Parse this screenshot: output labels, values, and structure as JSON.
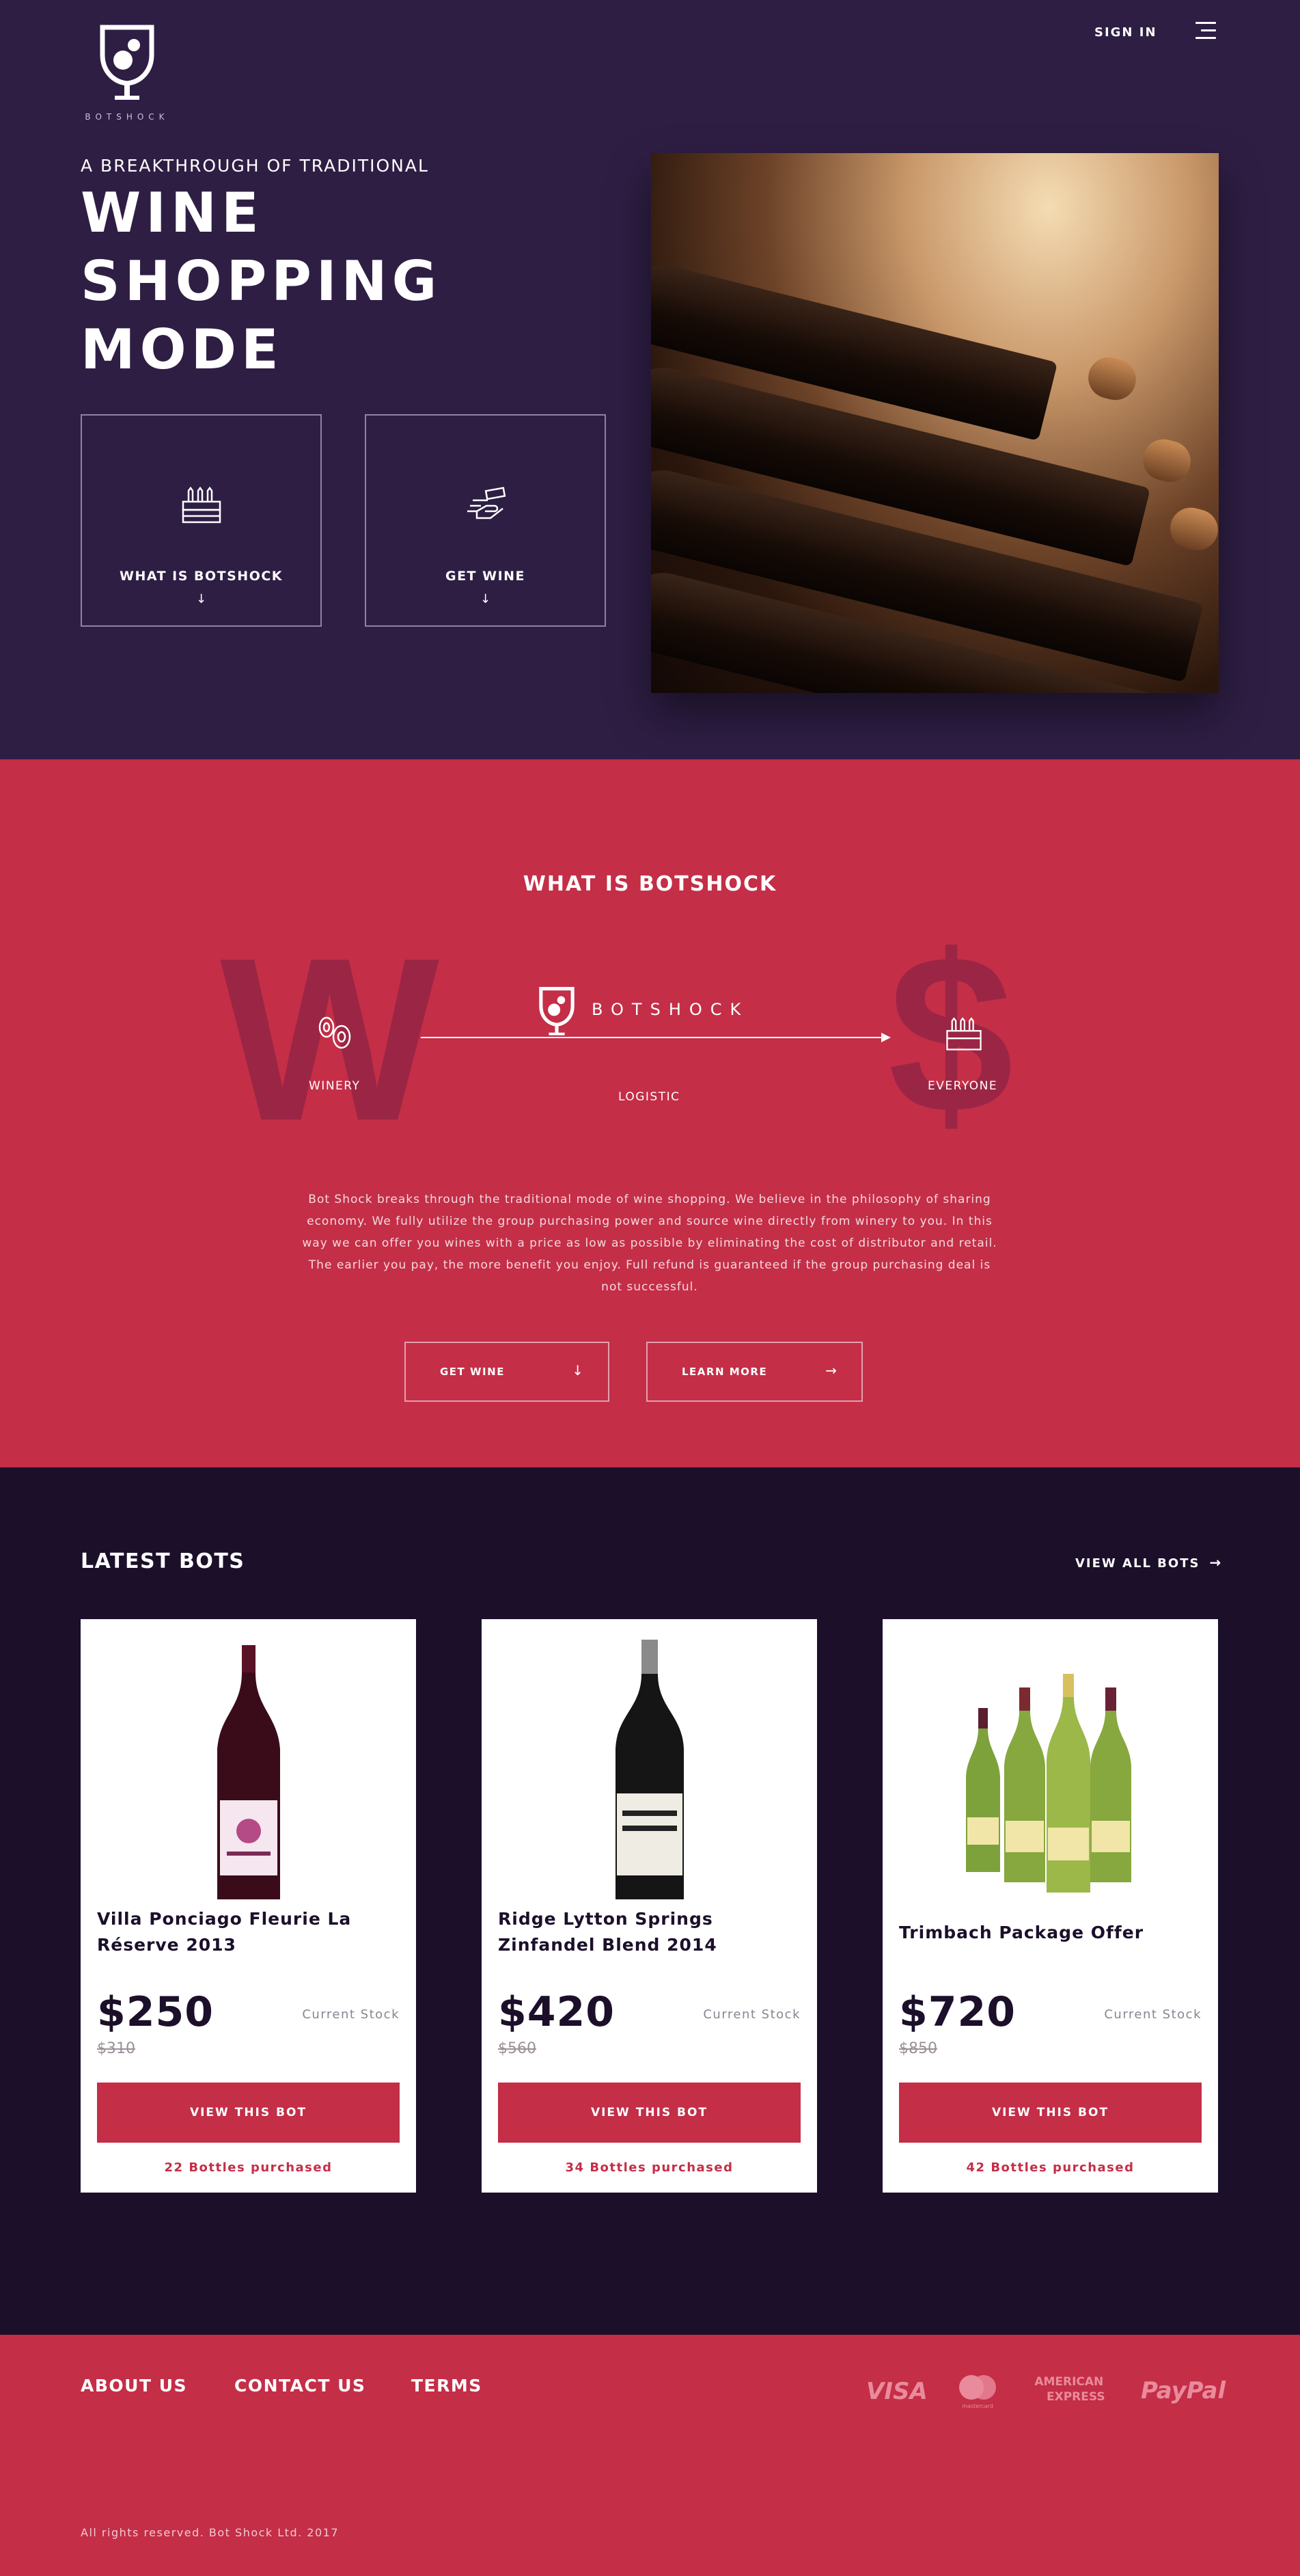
{
  "colors": {
    "hero_bg": "#2e1e44",
    "accent": "#c42e47",
    "dark_bg": "#1b0f2a"
  },
  "header": {
    "logo_text": "BOTSHOCK",
    "signin_label": "SIGN IN",
    "menu_icon": "hamburger-icon"
  },
  "hero": {
    "tagline": "A BREAKTHROUGH OF TRADITIONAL",
    "headline": "WINE SHOPPING MODE",
    "boxes": [
      {
        "label": "WHAT IS BOTSHOCK",
        "icon": "wine-crate-icon",
        "arrow": "↓"
      },
      {
        "label": "GET WINE",
        "icon": "hand-offer-icon",
        "arrow": "↓"
      }
    ]
  },
  "whatis": {
    "title": "WHAT IS BOTSHOCK",
    "big_left": "W",
    "big_right": "$",
    "logo_text": "BOTSHOCK",
    "flow": {
      "left": "WINERY",
      "middle": "LOGISTIC",
      "right": "EVERYONE"
    },
    "description": "Bot Shock breaks through the traditional mode of wine shopping. We believe in the philosophy of sharing economy. We fully utilize the group purchasing power and source wine directly from winery to you. In this way we can offer you wines with a price as low as possible by eliminating the cost of distributor and retail. The earlier you pay, the more benefit you enjoy. Full refund is guaranteed if the group purchasing deal is not successful.",
    "buttons": [
      {
        "label": "GET WINE",
        "arrow": "↓"
      },
      {
        "label": "LEARN MORE",
        "arrow": "→"
      }
    ]
  },
  "latest": {
    "title": "LATEST BOTS",
    "view_all": "VIEW ALL BOTS",
    "view_all_arrow": "→",
    "cards": [
      {
        "name": "Villa Ponciago Fleurie La Réserve 2013",
        "price": "$250",
        "old_price": "$310",
        "stock_label": "Current Stock",
        "button": "VIEW THIS BOT",
        "purchased": "22 Bottles purchased"
      },
      {
        "name": "Ridge Lytton Springs Zinfandel Blend 2014",
        "price": "$420",
        "old_price": "$560",
        "stock_label": "Current Stock",
        "button": "VIEW THIS BOT",
        "purchased": "34 Bottles purchased"
      },
      {
        "name": "Trimbach Package Offer",
        "price": "$720",
        "old_price": "$850",
        "stock_label": "Current Stock",
        "button": "VIEW THIS BOT",
        "purchased": "42 Bottles purchased"
      }
    ]
  },
  "footer": {
    "nav": [
      "ABOUT US",
      "CONTACT US",
      "TERMS"
    ],
    "payments": {
      "visa": "VISA",
      "mastercard": "mastercard",
      "amex_1": "AMERICAN",
      "amex_2": "EXPRESS",
      "paypal": "PayPal"
    },
    "copyright": "All rights reserved. Bot Shock Ltd. 2017"
  }
}
